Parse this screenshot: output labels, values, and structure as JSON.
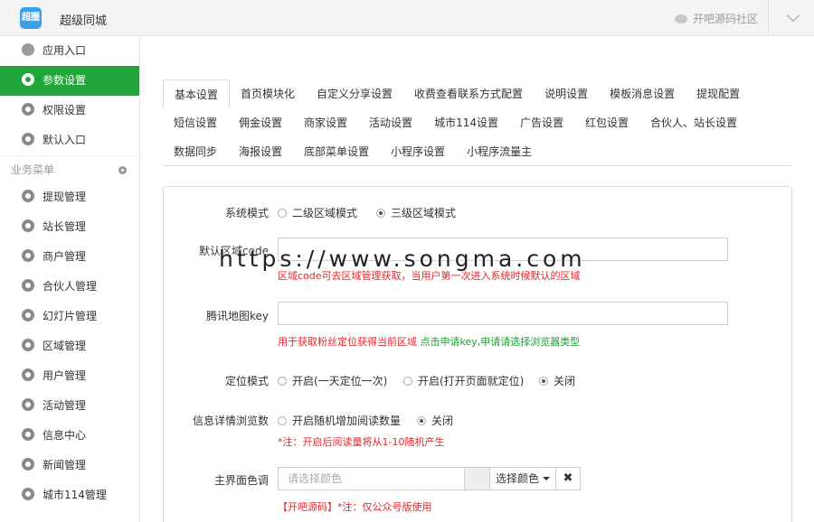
{
  "header": {
    "logo_text": "超圈",
    "title": "超级同城",
    "community": "开吧源码社区"
  },
  "sidebar": {
    "top_items": [
      {
        "label": "应用入口",
        "icon": "chat-icon"
      },
      {
        "label": "参数设置",
        "icon": "gear-icon",
        "active": true
      },
      {
        "label": "权限设置",
        "icon": "gear-icon"
      },
      {
        "label": "默认入口",
        "icon": "gear-icon"
      }
    ],
    "section_title": "业务菜单",
    "items": [
      {
        "label": "提现管理"
      },
      {
        "label": "站长管理"
      },
      {
        "label": "商户管理"
      },
      {
        "label": "合伙人管理"
      },
      {
        "label": "幻灯片管理"
      },
      {
        "label": "区域管理"
      },
      {
        "label": "用户管理"
      },
      {
        "label": "活动管理"
      },
      {
        "label": "信息中心"
      },
      {
        "label": "新闻管理"
      },
      {
        "label": "城市114管理"
      }
    ]
  },
  "tabs": {
    "row1": [
      "基本设置",
      "首页模块化",
      "自定义分享设置",
      "收费查看联系方式配置",
      "说明设置",
      "模板消息设置",
      "提现配置"
    ],
    "row2": [
      "短信设置",
      "佣金设置",
      "商家设置",
      "活动设置",
      "城市114设置",
      "广告设置",
      "红包设置",
      "合伙人、站长设置"
    ],
    "row3": [
      "数据同步",
      "海报设置",
      "底部菜单设置",
      "小程序设置",
      "小程序流量主"
    ]
  },
  "form": {
    "system_mode": {
      "label": "系统模式",
      "opt1": "二级区域模式",
      "opt2": "三级区域模式"
    },
    "default_area": {
      "label": "默认区域code",
      "hint": "区域code可去区域管理获取，当用户第一次进入系统时候默认的区域"
    },
    "map_key": {
      "label": "腾讯地图key",
      "hint_red": "用于获取粉丝定位获得当前区域 ",
      "hint_green": "点击申请key,申请请选择浏览器类型"
    },
    "locate_mode": {
      "label": "定位模式",
      "opt1": "开启(一天定位一次)",
      "opt2": "开启(打开页面就定位)",
      "opt3": "关闭"
    },
    "view_count": {
      "label": "信息详情浏览数",
      "opt1": "开启随机增加阅读数量",
      "opt2": "关闭",
      "hint": "*注：开启后阅读量将从1-10随机产生"
    },
    "theme_color": {
      "label": "主界面色调",
      "placeholder": "请选择颜色",
      "pick": "选择颜色",
      "clear": "✖",
      "hint": "【开吧源码】*注：仅公众号版使用"
    }
  },
  "watermark": "https://www.songma.com"
}
